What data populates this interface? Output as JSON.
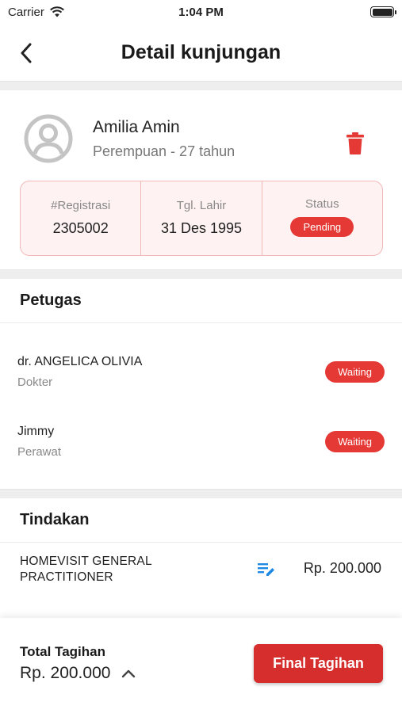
{
  "status_bar": {
    "carrier": "Carrier",
    "time": "1:04 PM"
  },
  "nav": {
    "title": "Detail kunjungan"
  },
  "patient": {
    "name": "Amilia Amin",
    "subtitle": "Perempuan - 27 tahun",
    "info": [
      {
        "label": "#Registrasi",
        "value": "2305002"
      },
      {
        "label": "Tgl. Lahir",
        "value": "31 Des 1995"
      },
      {
        "label": "Status",
        "badge": "Pending"
      }
    ]
  },
  "petugas": {
    "title": "Petugas",
    "staff": [
      {
        "name": "dr. ANGELICA OLIVIA",
        "role": "Dokter",
        "status": "Waiting"
      },
      {
        "name": "Jimmy",
        "role": "Perawat",
        "status": "Waiting"
      }
    ]
  },
  "tindakan": {
    "title": "Tindakan",
    "items": [
      {
        "name": "HOMEVISIT GENERAL PRACTITIONER",
        "price": "Rp. 200.000"
      }
    ]
  },
  "footer": {
    "total_label": "Total Tagihan",
    "total_value": "Rp. 200.000",
    "button_label": "Final Tagihan"
  },
  "colors": {
    "accent": "#e53935",
    "button": "#d62d2d",
    "edit_icon": "#1e88e5"
  }
}
